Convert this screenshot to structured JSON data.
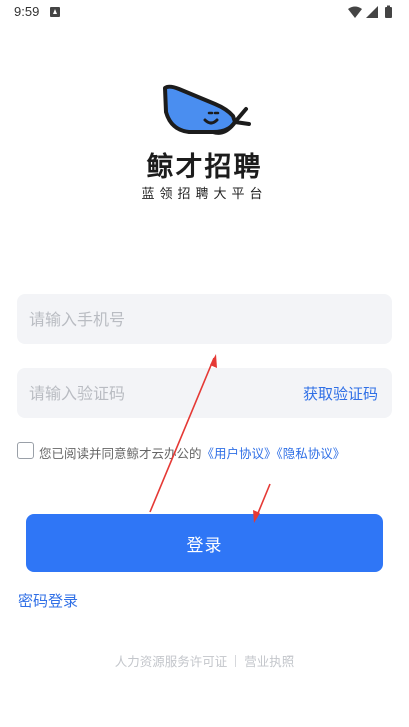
{
  "status_bar": {
    "time": "9:59"
  },
  "brand": {
    "app_name": "鲸才招聘",
    "slogan": "蓝领招聘大平台"
  },
  "form": {
    "phone_placeholder": "请输入手机号",
    "code_placeholder": "请输入验证码",
    "get_code_label": "获取验证码",
    "agreement": {
      "prefix": "您已阅读并同意鲸才云办公的",
      "user_agreement": "《用户协议》",
      "privacy_policy": "《隐私协议》"
    },
    "login_label": "登录",
    "password_login_label": "密码登录"
  },
  "footer": {
    "license_label": "人力资源服务许可证",
    "business_license_label": "营业执照"
  },
  "colors": {
    "accent": "#2f76f6",
    "link": "#2f6fe6",
    "field_bg": "#f3f4f7",
    "annotation": "#e53935"
  }
}
